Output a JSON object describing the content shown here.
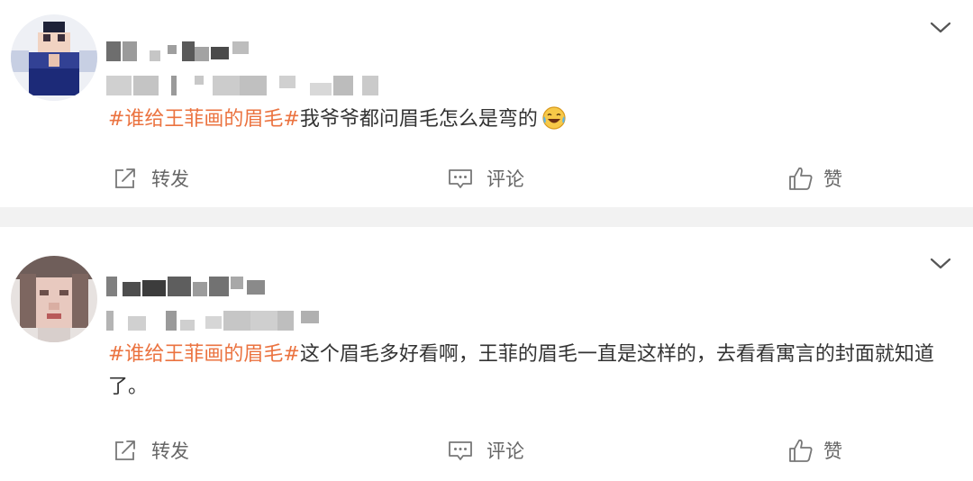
{
  "posts": [
    {
      "hashtag": "#谁给王菲画的眉毛#",
      "text": "我爷爷都问眉毛怎么是弯的",
      "emoji": "laugh-cry-emoji",
      "actions": {
        "repost": "转发",
        "comment": "评论",
        "like": "赞"
      }
    },
    {
      "hashtag": "#谁给王菲画的眉毛#",
      "text": "这个眉毛多好看啊，王菲的眉毛一直是这样的，去看看寓言的封面就知道了。",
      "actions": {
        "repost": "转发",
        "comment": "评论",
        "like": "赞"
      }
    }
  ],
  "colors": {
    "hashtag": "#eb7340",
    "divider": "#f2f2f2",
    "text": "#333333",
    "action_text": "#666666"
  }
}
